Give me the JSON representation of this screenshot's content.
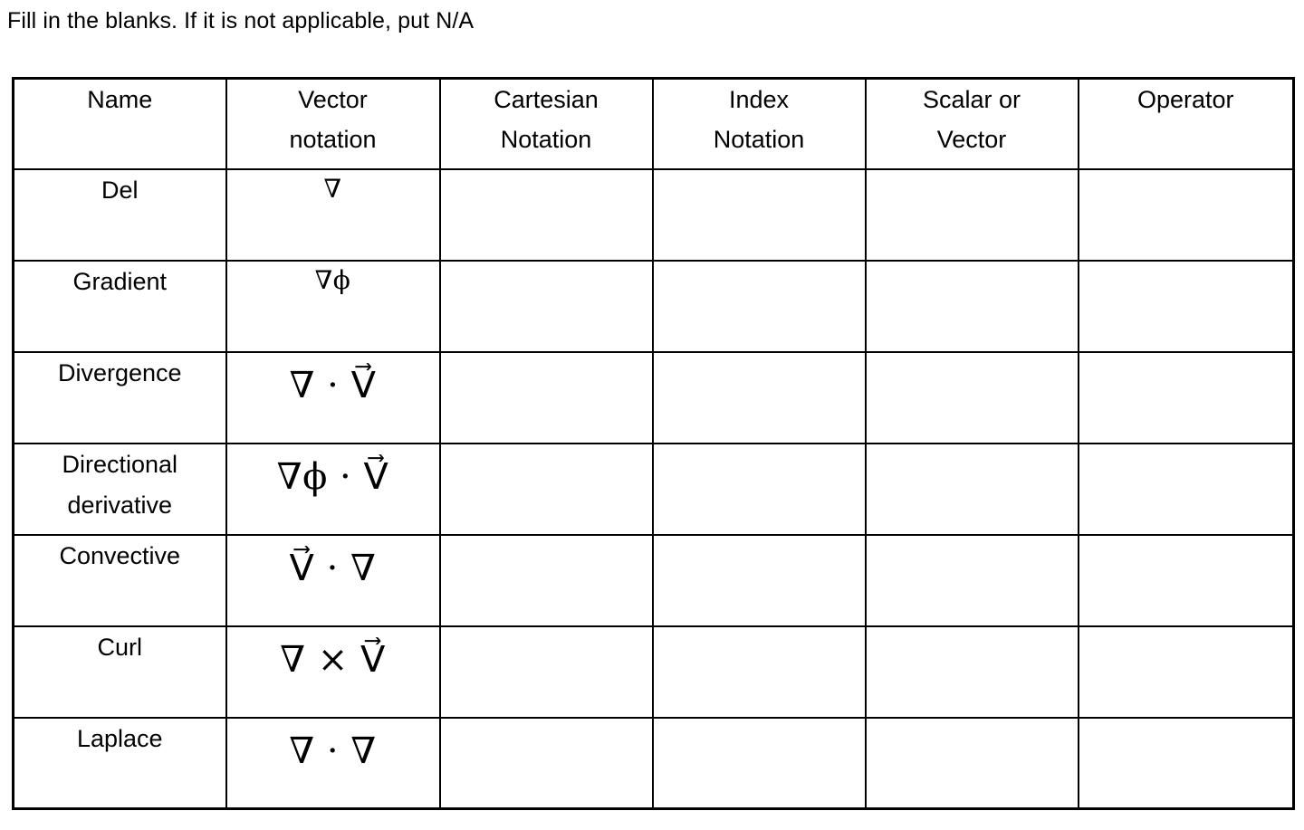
{
  "instruction": "Fill in the blanks. If it is not applicable, put N/A",
  "table": {
    "columns": [
      "Name",
      "Vector\nnotation",
      "Cartesian\nNotation",
      "Index\nNotation",
      "Scalar or\nVector",
      "Operator"
    ],
    "rows": [
      {
        "name": "Del",
        "vector_notation": "∇",
        "cartesian_notation": "",
        "index_notation": "",
        "scalar_or_vector": "",
        "operator": ""
      },
      {
        "name": "Gradient",
        "vector_notation": "∇ϕ",
        "cartesian_notation": "",
        "index_notation": "",
        "scalar_or_vector": "",
        "operator": ""
      },
      {
        "name": "Divergence",
        "vector_notation": "∇ · V⃗",
        "cartesian_notation": "",
        "index_notation": "",
        "scalar_or_vector": "",
        "operator": ""
      },
      {
        "name": "Directional\nderivative",
        "vector_notation": "∇ϕ · V⃗",
        "cartesian_notation": "",
        "index_notation": "",
        "scalar_or_vector": "",
        "operator": ""
      },
      {
        "name": "Convective",
        "vector_notation": "V⃗ · ∇",
        "cartesian_notation": "",
        "index_notation": "",
        "scalar_or_vector": "",
        "operator": ""
      },
      {
        "name": "Curl",
        "vector_notation": "∇ × V⃗",
        "cartesian_notation": "",
        "index_notation": "",
        "scalar_or_vector": "",
        "operator": ""
      },
      {
        "name": "Laplace",
        "vector_notation": "∇ · ∇",
        "cartesian_notation": "",
        "index_notation": "",
        "scalar_or_vector": "",
        "operator": ""
      }
    ]
  },
  "colors": {
    "background": "#ffffff",
    "text": "#000000",
    "border": "#000000"
  }
}
